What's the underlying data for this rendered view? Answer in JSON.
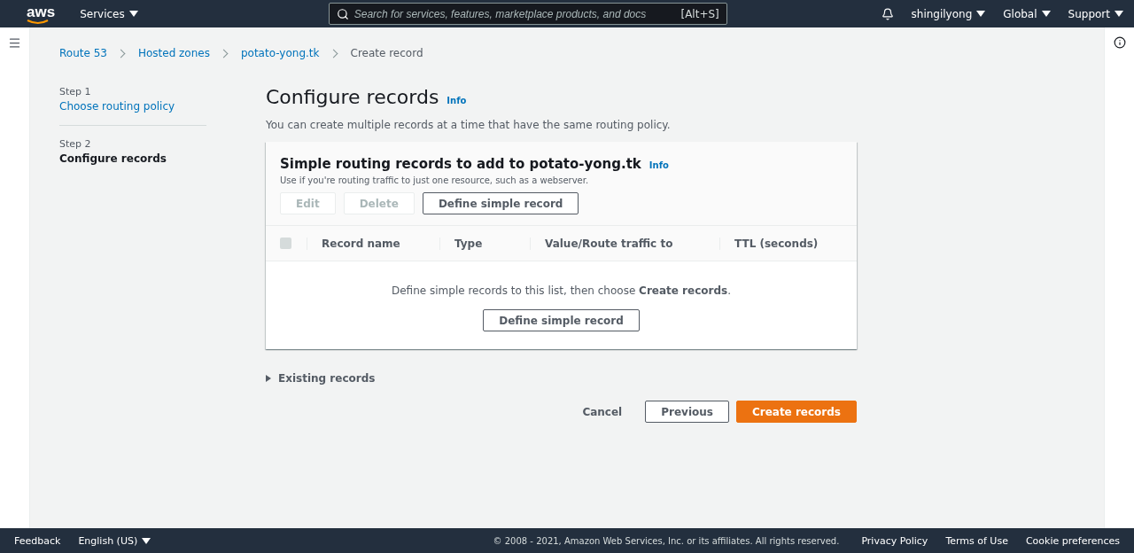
{
  "header": {
    "logo": "aws",
    "services": "Services",
    "search_placeholder": "Search for services, features, marketplace products, and docs",
    "shortcut": "[Alt+S]",
    "user": "shingilyong",
    "region": "Global",
    "support": "Support"
  },
  "breadcrumbs": [
    {
      "label": "Route 53",
      "current": false
    },
    {
      "label": "Hosted zones",
      "current": false
    },
    {
      "label": "potato-yong.tk",
      "current": false
    },
    {
      "label": "Create record",
      "current": true
    }
  ],
  "steps": [
    {
      "step": "Step 1",
      "title": "Choose routing policy",
      "selected": false
    },
    {
      "step": "Step 2",
      "title": "Configure records",
      "selected": true
    }
  ],
  "page": {
    "title": "Configure records",
    "info": "Info",
    "description": "You can create multiple records at a time that have the same routing policy."
  },
  "panel": {
    "title": "Simple routing records to add to potato-yong.tk",
    "info": "Info",
    "description": "Use if you're routing traffic to just one resource, such as a webserver.",
    "buttons": [
      {
        "label": "Edit",
        "disabled": true
      },
      {
        "label": "Delete",
        "disabled": true
      },
      {
        "label": "Define simple record",
        "disabled": false
      }
    ],
    "select_all": {
      "checked": false
    },
    "columns": [
      "Record name",
      "Type",
      "Value/Route traffic to",
      "TTL (seconds)"
    ],
    "empty_message": "Define simple records to this list, then choose **Create records**.",
    "empty_button": "Define simple record"
  },
  "existing_records": {
    "label": "Existing records",
    "expanded": false
  },
  "actions": [
    {
      "label": "Cancel",
      "kind": "link"
    },
    {
      "label": "Previous",
      "kind": "secondary"
    },
    {
      "label": "Create records",
      "kind": "primary"
    }
  ],
  "footer": {
    "feedback": "Feedback",
    "language": "English (US)",
    "copyright": "© 2008 - 2021, Amazon Web Services, Inc. or its affiliates. All rights reserved.",
    "links": [
      "Privacy Policy",
      "Terms of Use",
      "Cookie preferences"
    ]
  }
}
